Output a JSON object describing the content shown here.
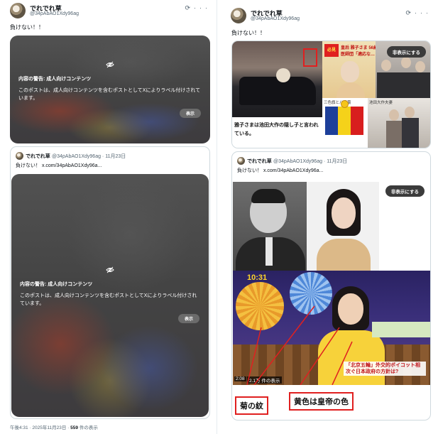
{
  "left_post": {
    "author_name": "でれでれ草",
    "author_handle": "@34pAbAO1Xdy96ag",
    "text": "負けない！！",
    "warning": {
      "title": "内容の警告: 成人向けコンテンツ",
      "body": "このポストは、成人向けコンテンツを含むポストとしてXによりラベル付けされています。",
      "show_label": "表示"
    },
    "quote": {
      "author_name": "でれでれ草",
      "author_handle": "@34pAbAO1Xdy96ag · 11月23日",
      "text": "負けない！ x.com/34pAbAO1Xdy96a...",
      "warning": {
        "title": "内容の警告: 成人向けコンテンツ",
        "body": "このポストは、成人向けコンテンツを含むポストとしてXによりラベル付けされています。",
        "show_label": "表示"
      }
    },
    "footer": {
      "timestamp": "午後4:31 · 2025年11月23日 · ",
      "views_count": "559",
      "views_label": " 件の表示"
    }
  },
  "right_post": {
    "author_name": "でれでれ草",
    "author_handle": "@34pAbAO1Xdy96ag",
    "text": "負けない！！",
    "hide_label": "非表示にする",
    "collage": {
      "caption": "雅子さまは池田大作の隠し子と言われている。",
      "banner": "皇后 雅子さま 56歳の誕生日",
      "banner2": "医師団「適応な…",
      "left_badge": "必見",
      "flag_caption": "三色旗と八重菊",
      "small_caption": "池田大作夫妻"
    },
    "quote": {
      "author_name": "でれでれ草",
      "author_handle": "@34pAbAO1Xdy96ag · 11月23日",
      "text": "負けない！ x.com/34pAbAO1Xdy96a...",
      "hide_label": "非表示にする",
      "tv": {
        "clock": "10:31",
        "headline": "「北京五輪」外交的ボイコット相次ぐ日本政府の方針は?",
        "views": "2.1万 件の表示",
        "time_left": "2:08",
        "label_chrysanthemum": "菊の紋",
        "label_yellow": "黄色は皇帝の色"
      }
    }
  },
  "colors": {
    "text": "#0f1419",
    "secondary": "#536471",
    "border": "#cfd9de",
    "annotation_red": "#e02020"
  },
  "icons": {
    "grok": "grok-icon",
    "more": "more-icon",
    "eye_off": "eye-off-icon"
  }
}
